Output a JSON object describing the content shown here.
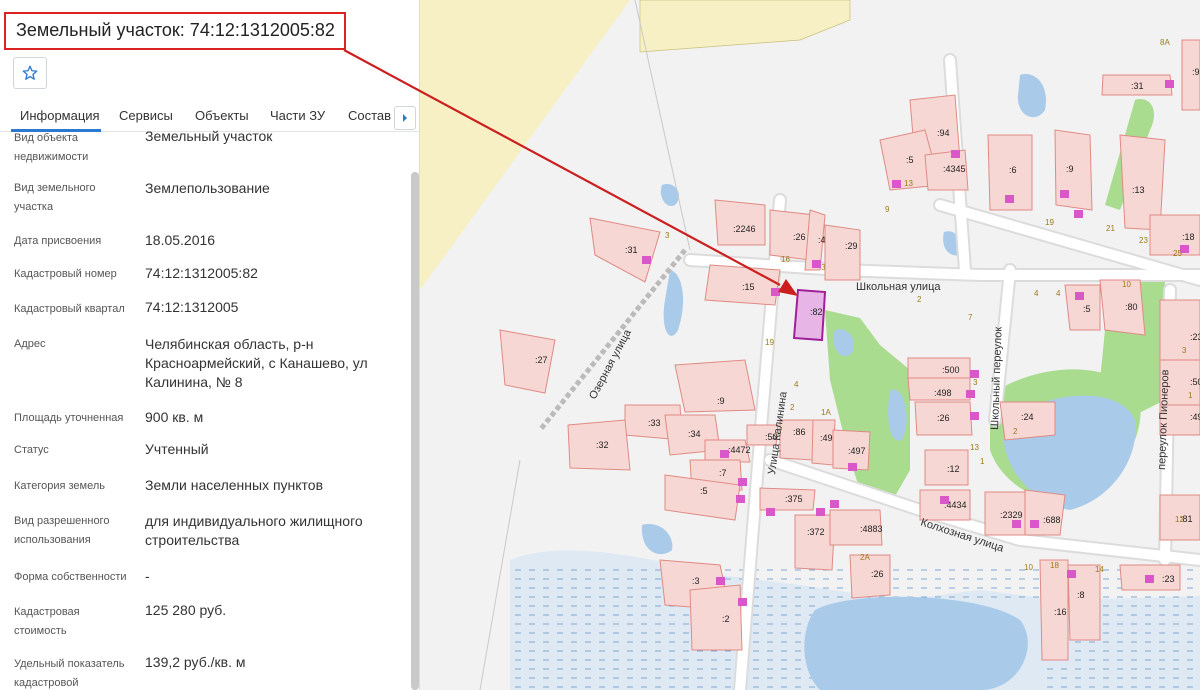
{
  "panel": {
    "title": "Земельный участок: 74:12:1312005:82",
    "favorite_icon": "star-icon",
    "tabs": [
      "Информация",
      "Сервисы",
      "Объекты",
      "Части ЗУ",
      "Состав"
    ],
    "active_tab": "Информация",
    "tab_next_icon": "chevron-right-icon",
    "rows": [
      {
        "key": "Вид объекта недвижимости",
        "value": "Земельный участок"
      },
      {
        "key": "Вид земельного участка",
        "value": "Землепользование"
      },
      {
        "key": "Дата присвоения",
        "value": "18.05.2016"
      },
      {
        "key": "Кадастровый номер",
        "value": "74:12:1312005:82"
      },
      {
        "key": "Кадастровый квартал",
        "value": "74:12:1312005"
      },
      {
        "key": "Адрес",
        "value": "Челябинская область, р-н Красноармейский, с Канашево, ул Калинина, № 8"
      },
      {
        "key": "Площадь уточненная",
        "value": "900 кв. м"
      },
      {
        "key": "Статус",
        "value": "Учтенный"
      },
      {
        "key": "Категория земель",
        "value": "Земли населенных пунктов"
      },
      {
        "key": "Вид разрешенного использования",
        "value": "для индивидуального жилищного строительства"
      },
      {
        "key": "Форма собственности",
        "value": "-"
      },
      {
        "key": "Кадастровая стоимость",
        "value": "125 280 руб."
      },
      {
        "key": "Удельный показатель кадастровой",
        "value": "139,2 руб./кв. м"
      }
    ]
  },
  "map": {
    "colors": {
      "parcel_fill": "#f7d7d4",
      "parcel_stroke": "#e08a84",
      "selected_fill": "#e7b6e7",
      "selected_stroke": "#a0209a",
      "water": "#a9cbe9",
      "green": "#a9dc8f",
      "sand": "#f6f0c4",
      "road": "#fafafa",
      "arrow": "#cc1f1f",
      "building": "#d957c8"
    },
    "streets": {
      "shkolnaya": "Школьная улица",
      "ozernaya": "Озерная улица",
      "kalinina": "Улица Калинина",
      "kolkhoznaya": "Колхозная улица",
      "shkolny_per": "Школьный переулок",
      "pionerov": "переулок Пионеров"
    },
    "parcels": [
      {
        "id": "p31",
        "label": ":31"
      },
      {
        "id": "p27",
        "label": ":27"
      },
      {
        "id": "p2246",
        "label": ":2246"
      },
      {
        "id": "p26a",
        "label": ":26"
      },
      {
        "id": "p4886",
        "label": ":4886"
      },
      {
        "id": "p29",
        "label": ":29"
      },
      {
        "id": "p15",
        "label": ":15"
      },
      {
        "id": "p82",
        "label": ":82"
      },
      {
        "id": "p94",
        "label": ":94"
      },
      {
        "id": "p5a",
        "label": ":5"
      },
      {
        "id": "p4345",
        "label": ":4345"
      },
      {
        "id": "p6",
        "label": ":6"
      },
      {
        "id": "p9a",
        "label": ":9"
      },
      {
        "id": "p13",
        "label": ":13"
      },
      {
        "id": "p31b",
        "label": ":31"
      },
      {
        "id": "p95",
        "label": ":95"
      },
      {
        "id": "p18",
        "label": ":18"
      },
      {
        "id": "p80",
        "label": ":80"
      },
      {
        "id": "p5b",
        "label": ":5"
      },
      {
        "id": "p23a",
        "label": ":23"
      },
      {
        "id": "p500",
        "label": ":500"
      },
      {
        "id": "p498",
        "label": ":498"
      },
      {
        "id": "p26b",
        "label": ":26"
      },
      {
        "id": "p24",
        "label": ":24"
      },
      {
        "id": "p501",
        "label": ":501"
      },
      {
        "id": "p495",
        "label": ":495"
      },
      {
        "id": "p9b",
        "label": ":9"
      },
      {
        "id": "p33",
        "label": ":33"
      },
      {
        "id": "p34",
        "label": ":34"
      },
      {
        "id": "p32",
        "label": ":32"
      },
      {
        "id": "p4472",
        "label": ":4472"
      },
      {
        "id": "p507",
        "label": ":507"
      },
      {
        "id": "p86",
        "label": ":86"
      },
      {
        "id": "p496",
        "label": ":496"
      },
      {
        "id": "p497",
        "label": ":497"
      },
      {
        "id": "p7",
        "label": ":7"
      },
      {
        "id": "p5c",
        "label": ":5"
      },
      {
        "id": "p12",
        "label": ":12"
      },
      {
        "id": "p4434",
        "label": ":4434"
      },
      {
        "id": "p375",
        "label": ":375"
      },
      {
        "id": "p372",
        "label": ":372"
      },
      {
        "id": "p4883",
        "label": ":4883"
      },
      {
        "id": "p2329",
        "label": ":2329"
      },
      {
        "id": "p688",
        "label": ":688"
      },
      {
        "id": "p81",
        "label": ":81"
      },
      {
        "id": "p3",
        "label": ":3"
      },
      {
        "id": "p2",
        "label": ":2"
      },
      {
        "id": "p26c",
        "label": ":26"
      },
      {
        "id": "p16",
        "label": ":16"
      },
      {
        "id": "p8",
        "label": ":8"
      },
      {
        "id": "p23b",
        "label": ":23"
      }
    ],
    "house_numbers": [
      "3",
      "9",
      "13",
      "16",
      "3",
      "2",
      "4",
      "4",
      "19",
      "21",
      "23",
      "25",
      "3",
      "1",
      "19",
      "4",
      "2",
      "1А",
      "7",
      "3",
      "13",
      "2",
      "1",
      "2А",
      "10",
      "18",
      "14",
      "12",
      "10",
      "8А",
      "95"
    ]
  }
}
